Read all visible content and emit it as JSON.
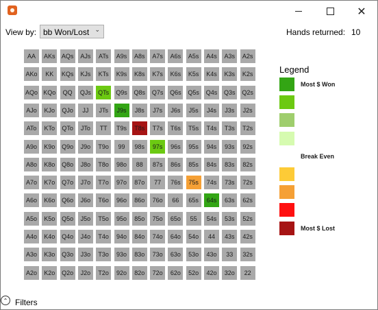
{
  "window": {
    "minimize_glyph": "",
    "close_glyph": "✕"
  },
  "toolbar": {
    "view_by_label": "View by:",
    "view_by_value": "bb Won/Lost",
    "hands_returned_label": "Hands returned:",
    "hands_returned_value": "10"
  },
  "grid": {
    "rows": [
      [
        "AA",
        "AKs",
        "AQs",
        "AJs",
        "ATs",
        "A9s",
        "A8s",
        "A7s",
        "A6s",
        "A5s",
        "A4s",
        "A3s",
        "A2s"
      ],
      [
        "AKo",
        "KK",
        "KQs",
        "KJs",
        "KTs",
        "K9s",
        "K8s",
        "K7s",
        "K6s",
        "K5s",
        "K4s",
        "K3s",
        "K2s"
      ],
      [
        "AQo",
        "KQo",
        "QQ",
        "QJs",
        "QTs",
        "Q9s",
        "Q8s",
        "Q7s",
        "Q6s",
        "Q5s",
        "Q4s",
        "Q3s",
        "Q2s"
      ],
      [
        "AJo",
        "KJo",
        "QJo",
        "JJ",
        "JTs",
        "J9s",
        "J8s",
        "J7s",
        "J6s",
        "J5s",
        "J4s",
        "J3s",
        "J2s"
      ],
      [
        "ATo",
        "KTo",
        "QTo",
        "JTo",
        "TT",
        "T9s",
        "T8s",
        "T7s",
        "T6s",
        "T5s",
        "T4s",
        "T3s",
        "T2s"
      ],
      [
        "A9o",
        "K9o",
        "Q9o",
        "J9o",
        "T9o",
        "99",
        "98s",
        "97s",
        "96s",
        "95s",
        "94s",
        "93s",
        "92s"
      ],
      [
        "A8o",
        "K8o",
        "Q8o",
        "J8o",
        "T8o",
        "98o",
        "88",
        "87s",
        "86s",
        "85s",
        "84s",
        "83s",
        "82s"
      ],
      [
        "A7o",
        "K7o",
        "Q7o",
        "J7o",
        "T7o",
        "97o",
        "87o",
        "77",
        "76s",
        "75s",
        "74s",
        "73s",
        "72s"
      ],
      [
        "A6o",
        "K6o",
        "Q6o",
        "J6o",
        "T6o",
        "96o",
        "86o",
        "76o",
        "66",
        "65s",
        "64s",
        "63s",
        "62s"
      ],
      [
        "A5o",
        "K5o",
        "Q5o",
        "J5o",
        "T5o",
        "95o",
        "85o",
        "75o",
        "65o",
        "55",
        "54s",
        "53s",
        "52s"
      ],
      [
        "A4o",
        "K4o",
        "Q4o",
        "J4o",
        "T4o",
        "94o",
        "84o",
        "74o",
        "64o",
        "54o",
        "44",
        "43s",
        "42s"
      ],
      [
        "A3o",
        "K3o",
        "Q3o",
        "J3o",
        "T3o",
        "93o",
        "83o",
        "73o",
        "63o",
        "53o",
        "43o",
        "33",
        "32s"
      ],
      [
        "A2o",
        "K2o",
        "Q2o",
        "J2o",
        "T2o",
        "92o",
        "82o",
        "72o",
        "62o",
        "52o",
        "42o",
        "32o",
        "22"
      ]
    ],
    "highlighted": {
      "QTs": "win2",
      "J9s": "win1",
      "T8s": "loss1",
      "97s": "win2",
      "75s": "loss3",
      "64s": "win1"
    }
  },
  "legend": {
    "title": "Legend",
    "items": [
      {
        "color": "#33a514",
        "label": "Most $ Won"
      },
      {
        "color": "#6cc912",
        "label": ""
      },
      {
        "color": "#9fce6d",
        "label": ""
      },
      {
        "color": "#d6fbb0",
        "label": ""
      },
      {
        "color": "#ffffff",
        "label": "Break Even"
      },
      {
        "color": "#fdcb37",
        "label": ""
      },
      {
        "color": "#f5a035",
        "label": ""
      },
      {
        "color": "#ff1010",
        "label": ""
      },
      {
        "color": "#a61414",
        "label": "Most $ Lost"
      }
    ]
  },
  "filters": {
    "icon": "chevron-up-icon",
    "label": "Filters"
  }
}
